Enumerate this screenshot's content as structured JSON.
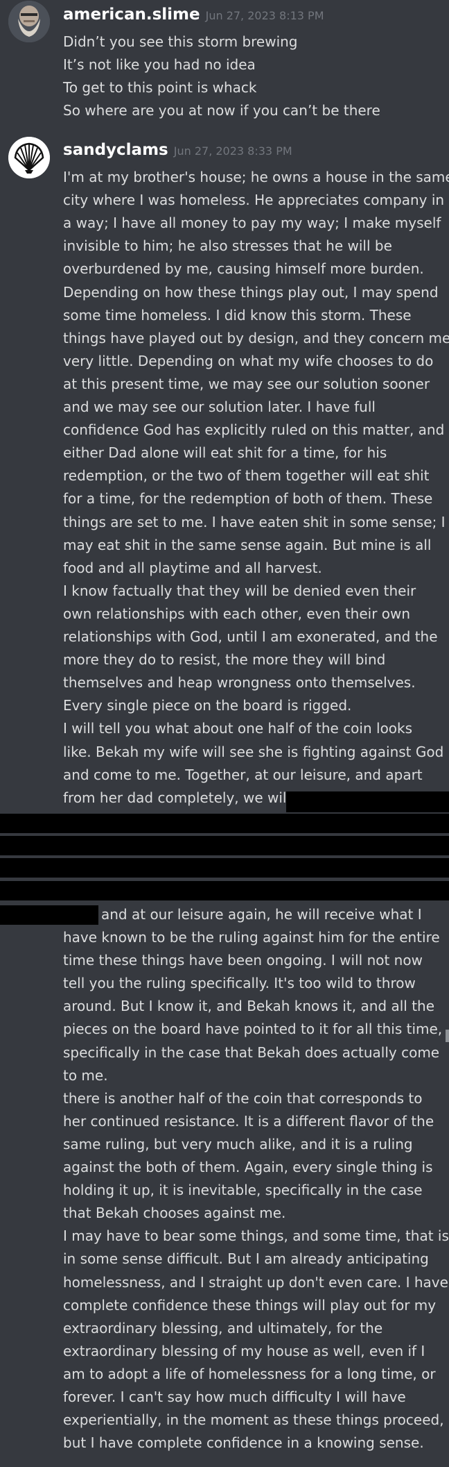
{
  "messages": [
    {
      "username": "american.slime",
      "timestamp": "Jun 27, 2023 8:13 PM",
      "avatar": "bearded-man-avatar",
      "lines": [
        "Didn’t you see this storm brewing",
        "It’s not like you had no idea",
        "To get to this point is whack",
        "So where are you at now if you can’t be there"
      ]
    },
    {
      "username": "sandyclams",
      "timestamp": "Jun 27, 2023 8:33 PM",
      "avatar": "seashell-avatar",
      "lines": [
        "I'm at my brother's house; he owns a house in the same",
        "city where I was homeless. He appreciates company in",
        "a way; I have all money to pay my way; I make myself",
        "invisible to him; he also stresses that he will be",
        "overburdened by me, causing himself more burden.",
        "Depending on how these things play out, I may spend",
        "some time homeless. I did know this storm. These",
        "things have played out by design, and they concern me",
        "very little. Depending on what my wife chooses to do",
        "at this present time, we may see our solution sooner",
        "and we may see our solution later. I have full",
        "confidence God has explicitly ruled on this matter, and",
        "either Dad alone will eat shit for a time, for his",
        "redemption, or the two of them together will eat shit",
        "for a time, for the redemption of both of them. These",
        "things are set to me. I have eaten shit in some sense; I",
        "may eat shit in the same sense again. But mine is all",
        "food and all playtime and all harvest.",
        "I know factually that they will be denied even their",
        "own relationships with each other, even their own",
        "relationships with God, until I am exonerated, and the",
        "more they do to resist, the more they will bind",
        "themselves and heap wrongness onto themselves.",
        "Every single piece on the board is rigged.",
        "I will tell you what about one half of the coin looks",
        "like. Bekah my wife will see she is fighting against God",
        "and come to me. Together, at our leisure, and apart",
        "from her dad completely, we will"
      ],
      "after_redaction_first": "and at our leisure again, he will receive what I",
      "lines_after": [
        "have known to be the ruling against him for the entire",
        "time these things have been ongoing. I will not now",
        "tell you the ruling specifically. It's too wild to throw",
        "around. But I know it, and Bekah knows it, and all the",
        "pieces on the board have pointed to it for all this time,",
        "specifically in the case that Bekah does actually come",
        "to me.",
        "there is another half of the coin that corresponds to",
        "her continued resistance. It is a different flavor of the",
        "same ruling, but very much alike, and it is a ruling",
        "against the both of them. Again, every single thing is",
        "holding it up, it is inevitable, specifically in the case",
        "that Bekah chooses against me.",
        "I may have to bear some things, and some time, that is",
        "in some sense difficult. But I am already anticipating",
        "homelessness, and I straight up don't even care. I have",
        "complete confidence these things will play out for my",
        "extraordinary blessing, and ultimately, for the",
        "extraordinary blessing of my house as well, even if I",
        "am to adopt a life of homelessness for a long time, or",
        "forever. I can't say how much difficulty I will have",
        "experientially, in the moment as these things proceed,",
        "but I have complete confidence in a knowing sense."
      ]
    }
  ]
}
